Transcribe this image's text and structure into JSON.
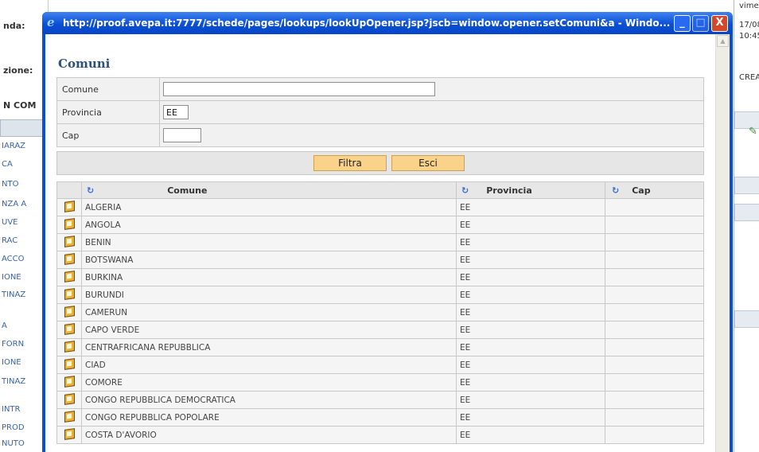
{
  "background": {
    "left_labels": [
      "nda:",
      "zione:",
      "N COM"
    ],
    "left_links": [
      "IARAZ",
      "CA",
      "NTO",
      "NZA A",
      "UVE",
      "RAC",
      "ACCO",
      "IONE",
      "TINAZ",
      "A",
      "FORN",
      "IONE",
      "TINAZ",
      "INTR",
      "PROD",
      "NUTO"
    ],
    "right_texts": [
      "vimen",
      "17/08",
      "10:45",
      "CREA"
    ]
  },
  "window": {
    "title": "http://proof.avepa.it:7777/schede/pages/lookups/lookUpOpener.jsp?jscb=window.opener.setComuni&a - Windo...",
    "minimize_label": "_",
    "maximize_label": "□",
    "close_label": "X"
  },
  "page": {
    "heading": "Comuni"
  },
  "filter": {
    "comune_label": "Comune",
    "comune_value": "",
    "provincia_label": "Provincia",
    "provincia_value": "EE",
    "cap_label": "Cap",
    "cap_value": "",
    "filtra_label": "Filtra",
    "esci_label": "Esci"
  },
  "results": {
    "headers": {
      "comune": "Comune",
      "provincia": "Provincia",
      "cap": "Cap"
    },
    "sort_icon": "refresh-sort-icon",
    "rows": [
      {
        "comune": "ALGERIA",
        "provincia": "EE",
        "cap": ""
      },
      {
        "comune": "ANGOLA",
        "provincia": "EE",
        "cap": ""
      },
      {
        "comune": "BENIN",
        "provincia": "EE",
        "cap": ""
      },
      {
        "comune": "BOTSWANA",
        "provincia": "EE",
        "cap": ""
      },
      {
        "comune": "BURKINA",
        "provincia": "EE",
        "cap": ""
      },
      {
        "comune": "BURUNDI",
        "provincia": "EE",
        "cap": ""
      },
      {
        "comune": "CAMERUN",
        "provincia": "EE",
        "cap": ""
      },
      {
        "comune": "CAPO VERDE",
        "provincia": "EE",
        "cap": ""
      },
      {
        "comune": "CENTRAFRICANA REPUBBLICA",
        "provincia": "EE",
        "cap": ""
      },
      {
        "comune": "CIAD",
        "provincia": "EE",
        "cap": ""
      },
      {
        "comune": "COMORE",
        "provincia": "EE",
        "cap": ""
      },
      {
        "comune": "CONGO REPUBBLICA DEMOCRATICA",
        "provincia": "EE",
        "cap": ""
      },
      {
        "comune": "CONGO REPUBBLICA POPOLARE",
        "provincia": "EE",
        "cap": ""
      },
      {
        "comune": "COSTA D'AVORIO",
        "provincia": "EE",
        "cap": ""
      }
    ]
  },
  "colors": {
    "titlebar": "#0a4fd6",
    "heading": "#2d4f7c",
    "button_fill": "#fbd28a",
    "sort_icon": "#3a6fd0"
  }
}
